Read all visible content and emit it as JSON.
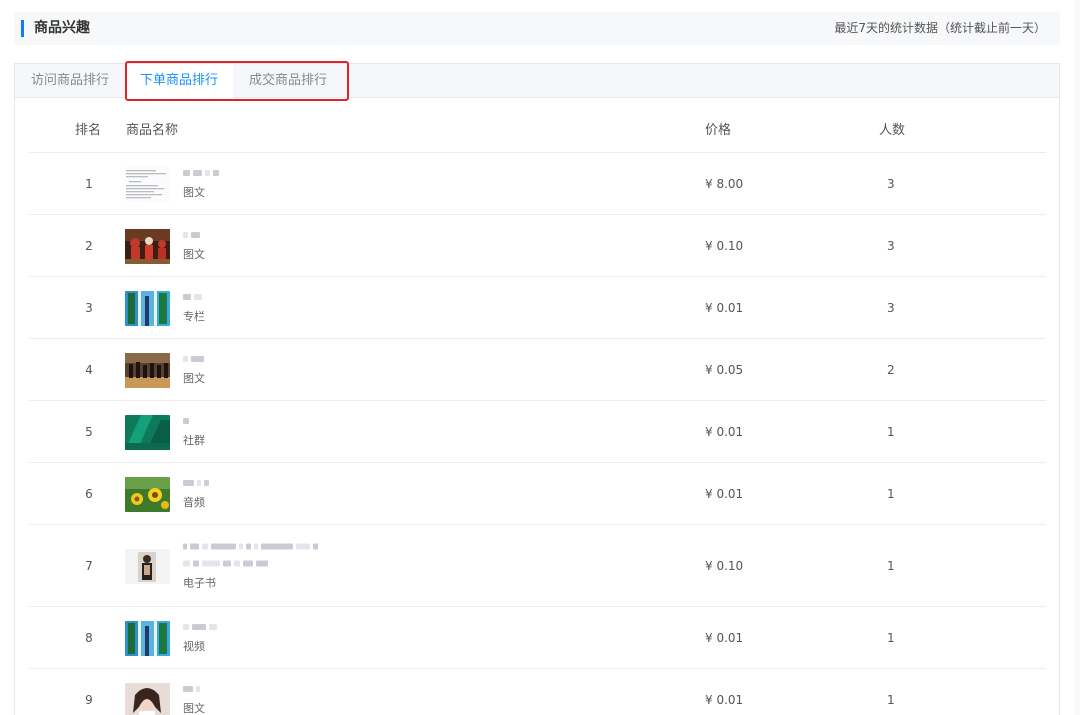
{
  "header": {
    "title": "商品兴趣",
    "note": "最近7天的统计数据（统计截止前一天）"
  },
  "tabs": [
    {
      "label": "访问商品排行",
      "active": false
    },
    {
      "label": "下单商品排行",
      "active": true
    },
    {
      "label": "成交商品排行",
      "active": false
    }
  ],
  "table": {
    "columns": {
      "rank": "排名",
      "name": "商品名称",
      "price": "价格",
      "count": "人数"
    },
    "rows": [
      {
        "rank": "1",
        "type": "图文",
        "price": "¥ 8.00",
        "count": "3",
        "thumb": "document-thumbnail"
      },
      {
        "rank": "2",
        "type": "图文",
        "price": "¥ 0.10",
        "count": "3",
        "thumb": "basketball-photo"
      },
      {
        "rank": "3",
        "type": "专栏",
        "price": "¥ 0.01",
        "count": "3",
        "thumb": "tower-photo"
      },
      {
        "rank": "4",
        "type": "图文",
        "price": "¥ 0.05",
        "count": "2",
        "thumb": "crowd-photo"
      },
      {
        "rank": "5",
        "type": "社群",
        "price": "¥ 0.01",
        "count": "1",
        "thumb": "green-banner"
      },
      {
        "rank": "6",
        "type": "音频",
        "price": "¥ 0.01",
        "count": "1",
        "thumb": "flower-photo"
      },
      {
        "rank": "7",
        "type": "电子书",
        "price": "¥ 0.10",
        "count": "1",
        "thumb": "portrait-photo"
      },
      {
        "rank": "8",
        "type": "视频",
        "price": "¥ 0.01",
        "count": "1",
        "thumb": "tower-photo"
      },
      {
        "rank": "9",
        "type": "图文",
        "price": "¥ 0.01",
        "count": "1",
        "thumb": "woman-portrait"
      }
    ]
  },
  "colors": {
    "accent": "#1677ff",
    "active_tab": "#1890ff",
    "highlight_box": "#e02424"
  }
}
